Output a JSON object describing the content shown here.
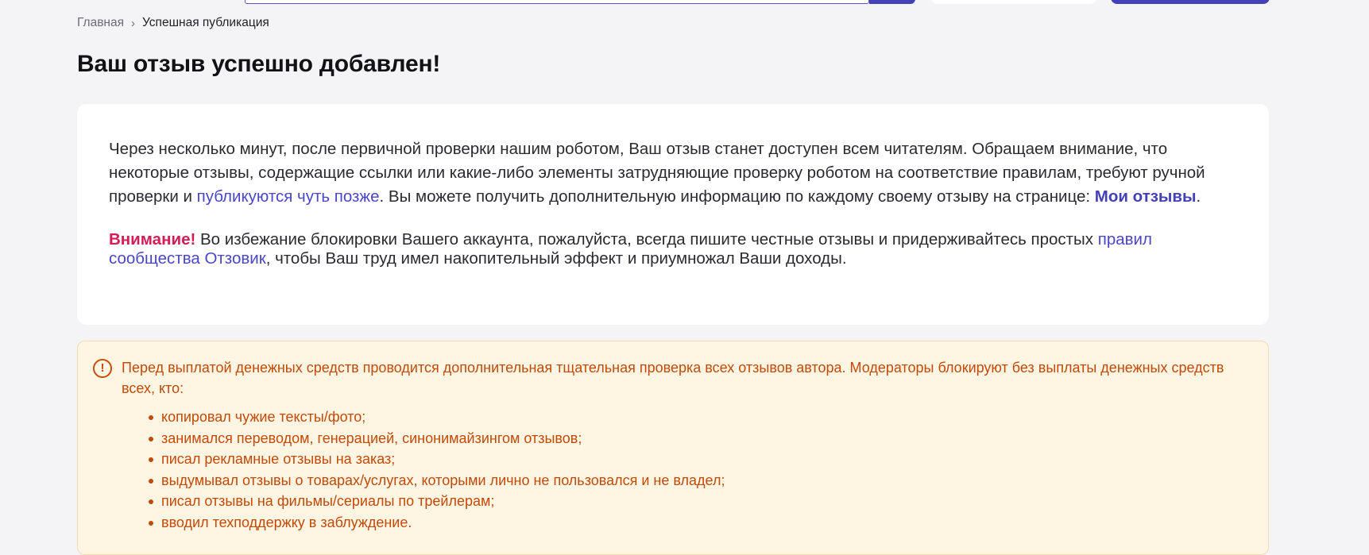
{
  "breadcrumb": {
    "home": "Главная",
    "separator": "›",
    "current": "Успешная публикация"
  },
  "title": "Ваш отзыв успешно добавлен!",
  "info": {
    "p1_before_link": "Через несколько минут, после первичной проверки нашим роботом, Ваш отзыв станет доступен всем читателям. Обращаем внимание, что некоторые отзывы, содержащие ссылки или какие-либо элементы затрудняющие проверку роботом на соответствие правилам, требуют ручной проверки и ",
    "p1_link": "публикуются чуть позже",
    "p1_after_link": ". Вы можете получить дополнительную информацию по каждому своему отзыву на странице: ",
    "my_reviews_link": "Мои отзывы",
    "p1_end": ".",
    "attention_label": "Внимание!",
    "p2_text": " Во избежание блокировки Вашего аккаунта, пожалуйста, всегда пишите честные отзывы и придерживайтесь простых ",
    "rules_link": "правил сообщества Отзовик",
    "p2_end": ", чтобы Ваш труд имел накопительный эффект и приумножал Ваши доходы."
  },
  "warning": {
    "icon": "exclamation-circle-icon",
    "icon_glyph": "!",
    "text": "Перед выплатой денежных средств проводится дополнительная тщательная проверка всех отзывов автора. Модераторы блокируют без выплаты денежных средств всех, кто:",
    "items": [
      "копировал чужие тексты/фото;",
      "занимался переводом, генерацией, синонимайзингом отзывов;",
      "писал рекламные отзывы на заказ;",
      "выдумывал отзывы о товарах/услугах, которыми лично не пользовался и не владел;",
      "писал отзывы на фильмы/сериалы по трейлерам;",
      "вводил техподдержку в заблуждение."
    ]
  },
  "colors": {
    "accent": "#4441b8",
    "link": "#4a46c9",
    "attention": "#d51d55",
    "warning_text": "#c24a05",
    "warning_bg": "#fff5e3",
    "page_bg": "#f4f4f7"
  }
}
